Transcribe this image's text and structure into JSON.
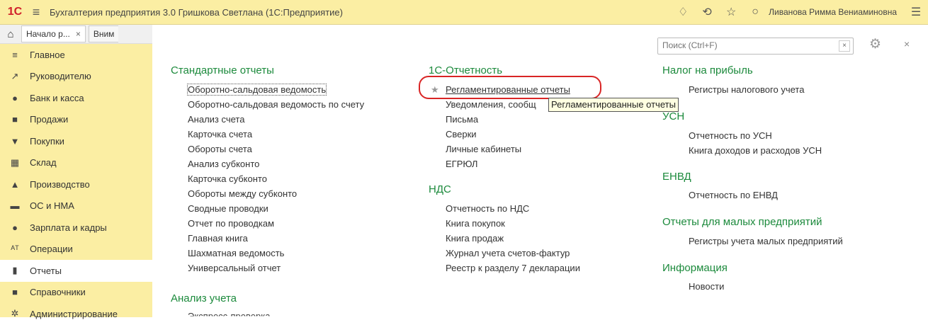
{
  "titlebar": {
    "logo": "1С",
    "title": "Бухгалтерия предприятия 3.0 Гришкова Светлана  (1С:Предприятие)",
    "user": "Ливанова Римма Вениаминовна"
  },
  "tabs": [
    {
      "label": "Начало р...",
      "close": "×"
    },
    {
      "label": "Вним"
    }
  ],
  "sidebar": {
    "items": [
      {
        "label": "Главное",
        "icon": "≡"
      },
      {
        "label": "Руководителю",
        "icon": "↗"
      },
      {
        "label": "Банк и касса",
        "icon": "●"
      },
      {
        "label": "Продажи",
        "icon": "■"
      },
      {
        "label": "Покупки",
        "icon": "▼"
      },
      {
        "label": "Склад",
        "icon": "▦"
      },
      {
        "label": "Производство",
        "icon": "▲"
      },
      {
        "label": "ОС и НМА",
        "icon": "▬"
      },
      {
        "label": "Зарплата и кадры",
        "icon": "●"
      },
      {
        "label": "Операции",
        "icon": "ᴬᵀ"
      },
      {
        "label": "Отчеты",
        "icon": "▮"
      },
      {
        "label": "Справочники",
        "icon": "■"
      },
      {
        "label": "Администрирование",
        "icon": "✲"
      }
    ]
  },
  "search": {
    "placeholder": "Поиск (Ctrl+F)",
    "clear": "×"
  },
  "col1": {
    "sections": [
      {
        "title": "Стандартные отчеты",
        "links": [
          "Оборотно-сальдовая ведомость",
          "Оборотно-сальдовая ведомость по счету",
          "Анализ счета",
          "Карточка счета",
          "Обороты счета",
          "Анализ субконто",
          "Карточка субконто",
          "Обороты между субконто",
          "Сводные проводки",
          "Отчет по проводкам",
          "Главная книга",
          "Шахматная ведомость",
          "Универсальный отчет"
        ]
      },
      {
        "title": "Анализ учета",
        "links": [
          "Экспресс-проверка"
        ]
      }
    ]
  },
  "col2": {
    "sections": [
      {
        "title": "1С-Отчетность",
        "links": [
          "Регламентированные отчеты",
          "Уведомления, сообщ",
          "Письма",
          "Сверки",
          "Личные кабинеты",
          "ЕГРЮЛ"
        ]
      },
      {
        "title": "НДС",
        "links": [
          "Отчетность по НДС",
          "Книга покупок",
          "Книга продаж",
          "Журнал учета счетов-фактур",
          "Реестр к разделу 7 декларации"
        ]
      }
    ]
  },
  "col3": {
    "sections": [
      {
        "title": "Налог на прибыль",
        "links": [
          "Регистры налогового учета"
        ]
      },
      {
        "title": "УСН",
        "links": [
          "Отчетность по УСН",
          "Книга доходов и расходов УСН"
        ]
      },
      {
        "title": "ЕНВД",
        "links": [
          "Отчетность по ЕНВД"
        ]
      },
      {
        "title": "Отчеты для малых предприятий",
        "links": [
          "Регистры учета малых предприятий"
        ]
      },
      {
        "title": "Информация",
        "links": [
          "Новости"
        ]
      }
    ]
  },
  "tooltip": "Регламентированные отчеты",
  "colors": {
    "accent_green": "#1c8a3c",
    "sidebar_bg": "#fbeea3",
    "highlight_red": "#d92525"
  }
}
